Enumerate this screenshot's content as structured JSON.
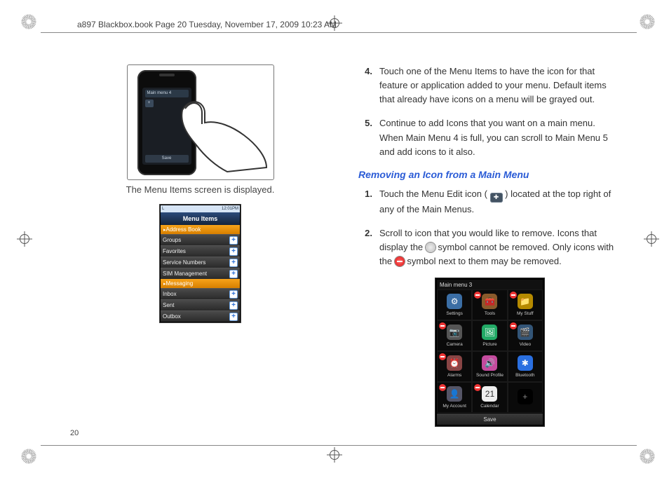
{
  "header_text": "a897 Blackbox.book  Page 20  Tuesday, November 17, 2009  10:23 AM",
  "page_number": "20",
  "left": {
    "phone_title": "Main menu 4",
    "phone_save": "Save",
    "caption": "The Menu Items screen is displayed.",
    "menu_status_left": "L",
    "menu_status_right": "12:01PM",
    "menu_title": "Menu Items",
    "sections": [
      {
        "label": "Address Book",
        "rows": [
          "Groups",
          "Favorites",
          "Service Numbers",
          "SIM Management"
        ]
      },
      {
        "label": "Messaging",
        "rows": [
          "Inbox",
          "Sent",
          "Outbox"
        ]
      }
    ]
  },
  "right": {
    "steps_a": [
      {
        "n": "4.",
        "t": "Touch one of the Menu Items to have the icon for that feature or application added to your menu. Default items that already have icons on a menu will be grayed out."
      },
      {
        "n": "5.",
        "t": "Continue to add Icons that you want on a main menu. When Main Menu 4 is full, you can scroll to Main Menu 5 and add icons to it also."
      }
    ],
    "subhead": "Removing an Icon from a Main Menu",
    "step_b1_n": "1.",
    "step_b1_pre": "Touch the Menu Edit icon (",
    "step_b1_post": ") located at the top right of any of the Main Menus.",
    "step_b2_n": "2.",
    "step_b2_a": "Scroll to icon that you would like to remove. Icons that display the ",
    "step_b2_b": " symbol cannot be removed. Only icons with the ",
    "step_b2_c": " symbol next to them may be removed.",
    "mm3": {
      "title": "Main menu 3",
      "save": "Save",
      "cells": [
        {
          "label": "Settings",
          "glyph": "⚙",
          "bg": "#3b6ea5",
          "rm": false
        },
        {
          "label": "Tools",
          "glyph": "🧰",
          "bg": "#8a5a2b",
          "rm": true
        },
        {
          "label": "My Stuff",
          "glyph": "📁",
          "bg": "#b58a00",
          "rm": true
        },
        {
          "label": "Camera",
          "glyph": "📷",
          "bg": "#555",
          "rm": true
        },
        {
          "label": "Picture",
          "glyph": "🖼",
          "bg": "#2a6",
          "rm": false
        },
        {
          "label": "Video",
          "glyph": "🎬",
          "bg": "#357",
          "rm": true
        },
        {
          "label": "Alarms",
          "glyph": "⏰",
          "bg": "#844",
          "rm": true
        },
        {
          "label": "Sound Profile",
          "glyph": "🔊",
          "bg": "#c44b9e",
          "rm": false
        },
        {
          "label": "Bluetooth",
          "glyph": "✱",
          "bg": "#2a6fe0",
          "rm": false
        },
        {
          "label": "My Account",
          "glyph": "👤",
          "bg": "#556",
          "rm": true
        },
        {
          "label": "Calendar",
          "glyph": "21",
          "bg": "#eee",
          "rm": true,
          "fg": "#333"
        },
        {
          "label": "",
          "glyph": "+",
          "bg": "#000",
          "rm": false,
          "fg": "#888"
        }
      ]
    }
  }
}
